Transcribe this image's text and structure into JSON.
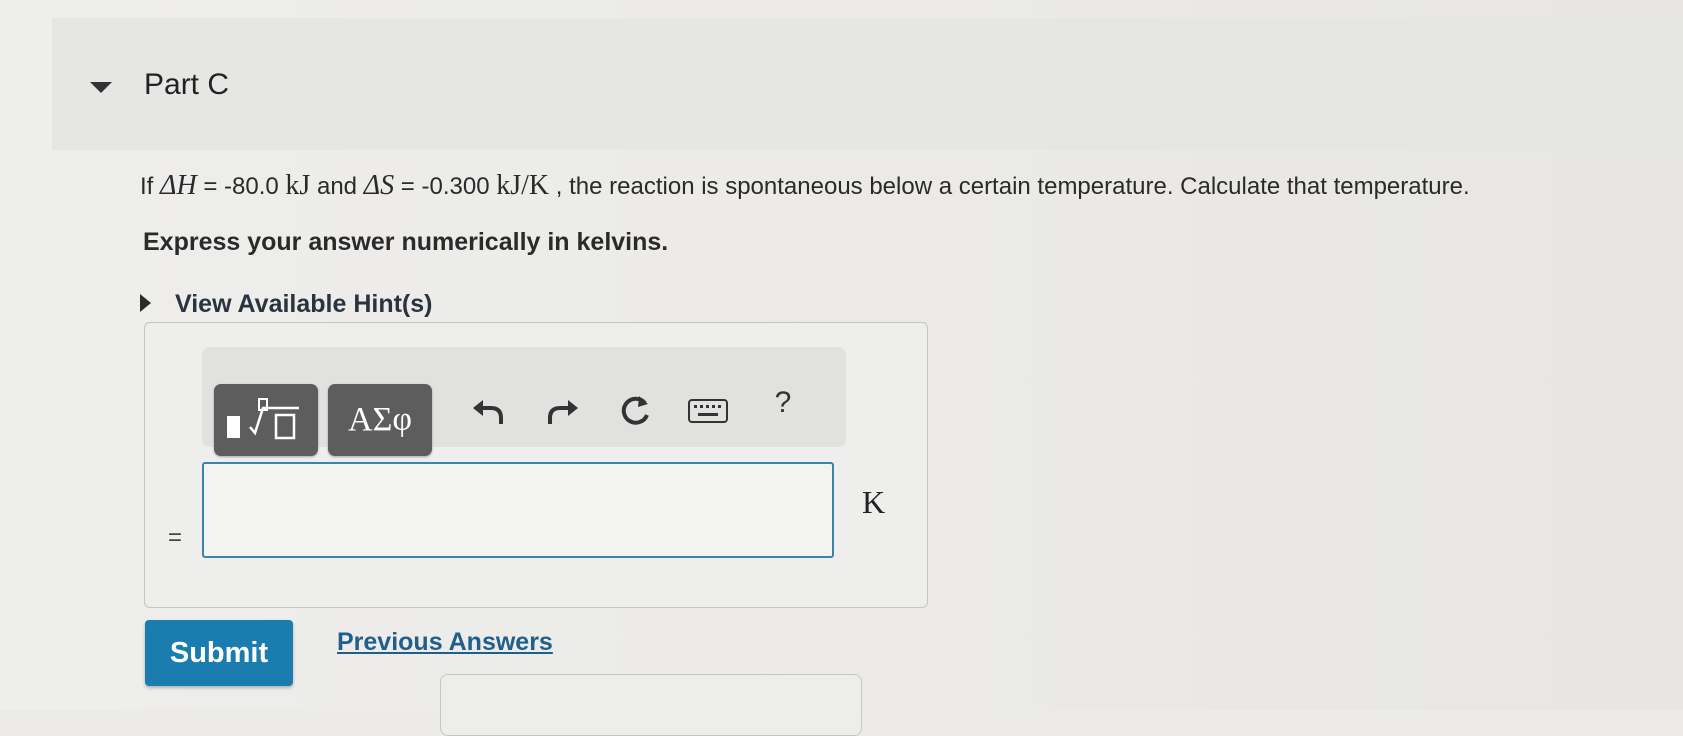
{
  "part": {
    "title": "Part C",
    "collapse_icon": "caret-down-icon"
  },
  "question": {
    "prefix": "If ",
    "dh_symbol": "ΔH",
    "dh_eq": " = -80.0 ",
    "dh_unit": "kJ",
    "and_text": " and ",
    "ds_symbol": "ΔS",
    "ds_eq": " = -0.300 ",
    "ds_unit": "kJ/K",
    "suffix": " , the reaction is spontaneous below a certain temperature. Calculate that temperature."
  },
  "instruction": "Express your answer numerically in kelvins.",
  "hints": {
    "label": "View Available Hint(s)",
    "icon": "caret-right-icon"
  },
  "toolbar": {
    "greek_label": "ΑΣφ",
    "help_label": "?",
    "icons": [
      "templates-icon",
      "undo-icon",
      "redo-icon",
      "reset-icon",
      "keyboard-icon",
      "help-icon"
    ]
  },
  "answer": {
    "equals": "=",
    "value": "",
    "unit": "K"
  },
  "actions": {
    "submit_label": "Submit",
    "previous_answers_label": "Previous Answers"
  },
  "colors": {
    "accent": "#1b7caf",
    "input_border": "#3d82ad",
    "toolbar_button": "#5d5d5d",
    "link": "#1f5f8a"
  }
}
